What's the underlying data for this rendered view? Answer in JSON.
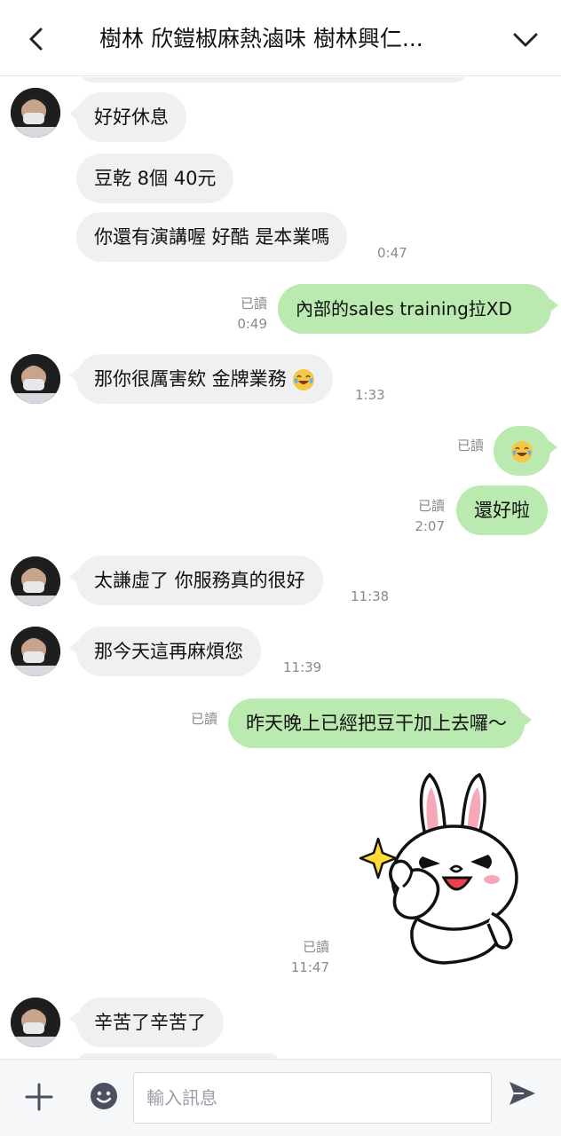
{
  "header": {
    "title": "樹林 欣鎧椒麻熱滷味 樹林興仁...",
    "back_icon": "chevron-left-icon",
    "expand_icon": "chevron-down-icon"
  },
  "messages": [
    {
      "side": "in",
      "text": "好好休息"
    },
    {
      "side": "in",
      "text": "豆乾 8個 40元"
    },
    {
      "side": "in",
      "text": "你還有演講喔 好酷 是本業嗎",
      "time": "0:47"
    },
    {
      "side": "out",
      "text": "內部的sales training拉XD",
      "read": "已讀",
      "time": "0:49"
    },
    {
      "side": "in",
      "text": "那你很厲害欸 金牌業務",
      "emoji": "😂",
      "time": "1:33"
    },
    {
      "side": "out",
      "emoji": "😂",
      "read": "已讀"
    },
    {
      "side": "out",
      "text": "還好啦",
      "read": "已讀",
      "time": "2:07"
    },
    {
      "side": "in",
      "text": "太謙虛了 你服務真的很好",
      "time": "11:38"
    },
    {
      "side": "in",
      "text": "那今天這再麻煩您",
      "time": "11:39"
    },
    {
      "side": "out",
      "text": "昨天晚上已經把豆干加上去囉～",
      "read": "已讀"
    },
    {
      "side": "out",
      "sticker": "bunny-thumbs-up-sticker",
      "read": "已讀",
      "time": "11:47"
    },
    {
      "side": "in",
      "text": "辛苦了辛苦了"
    }
  ],
  "input": {
    "placeholder": "輸入訊息",
    "value": "",
    "plus_icon": "plus-icon",
    "emoji_icon": "smiley-icon",
    "send_icon": "send-icon"
  },
  "colors": {
    "incoming_bubble": "#eef0f2",
    "outgoing_bubble": "#baeaaf",
    "meta_text": "#8a8a8a"
  }
}
